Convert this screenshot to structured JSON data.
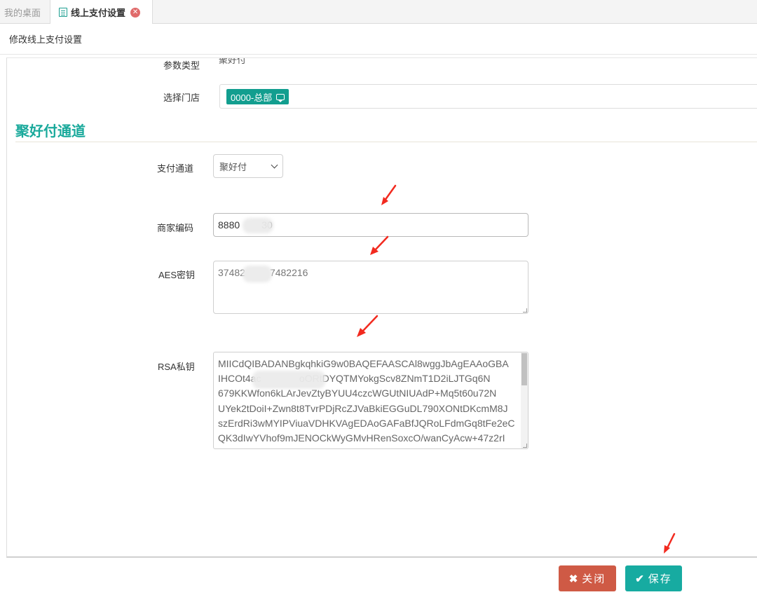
{
  "tabs": [
    {
      "label": "我的桌面"
    },
    {
      "label": "线上支付设置"
    }
  ],
  "header": {
    "title": "修改线上支付设置"
  },
  "form": {
    "param_type_label": "参数类型",
    "param_type_value": "聚好付",
    "store_label": "选择门店",
    "store_tag": "0000-总部",
    "section_title": "聚好付通道",
    "channel_label": "支付通道",
    "channel_value": "聚好付",
    "merchant_label": "商家编码",
    "merchant_value": "8880        30",
    "aes_label": "AES密钥",
    "aes_value": "37482         7482216",
    "rsa_label": "RSA私钥",
    "rsa_lines": [
      "MIICdQIBADANBgkqhkiG9w0BAQEFAASCAl8wggJbAgEAAoGBA",
      "IHCOt4ac              oORtDYQTMYokgScv8ZNmT1D2iLJTGq6N",
      "679KKWfon6kLArJevZtyBYUU4czcWGUtNIUAdP+Mq5t60u72N",
      "UYek2tDoiI+Zwn8t8TvrPDjRcZJVaBkiEGGuDL790XONtDKcmM8J",
      "szErdRi3wMYIPViuaVDHKVAgEDAoGAFaBfJQRoLFdmGq8tFe2eC",
      "QK3dIwYVhof9mJENOCkWyGMvHRenSoxcO/wanCyAcw+47z2rI"
    ]
  },
  "buttons": {
    "close_label": "关闭",
    "save_label": "保存"
  },
  "colors": {
    "accent": "#19a99b",
    "close_button": "#cf5a45",
    "save_button": "#17aba1",
    "arrow": "#f22a1f"
  },
  "icons": {
    "tab_doc": "document-icon",
    "tab_close": "close-circle-icon",
    "store_tag": "chat-icon",
    "close_btn": "x-icon",
    "save_btn": "check-icon"
  }
}
